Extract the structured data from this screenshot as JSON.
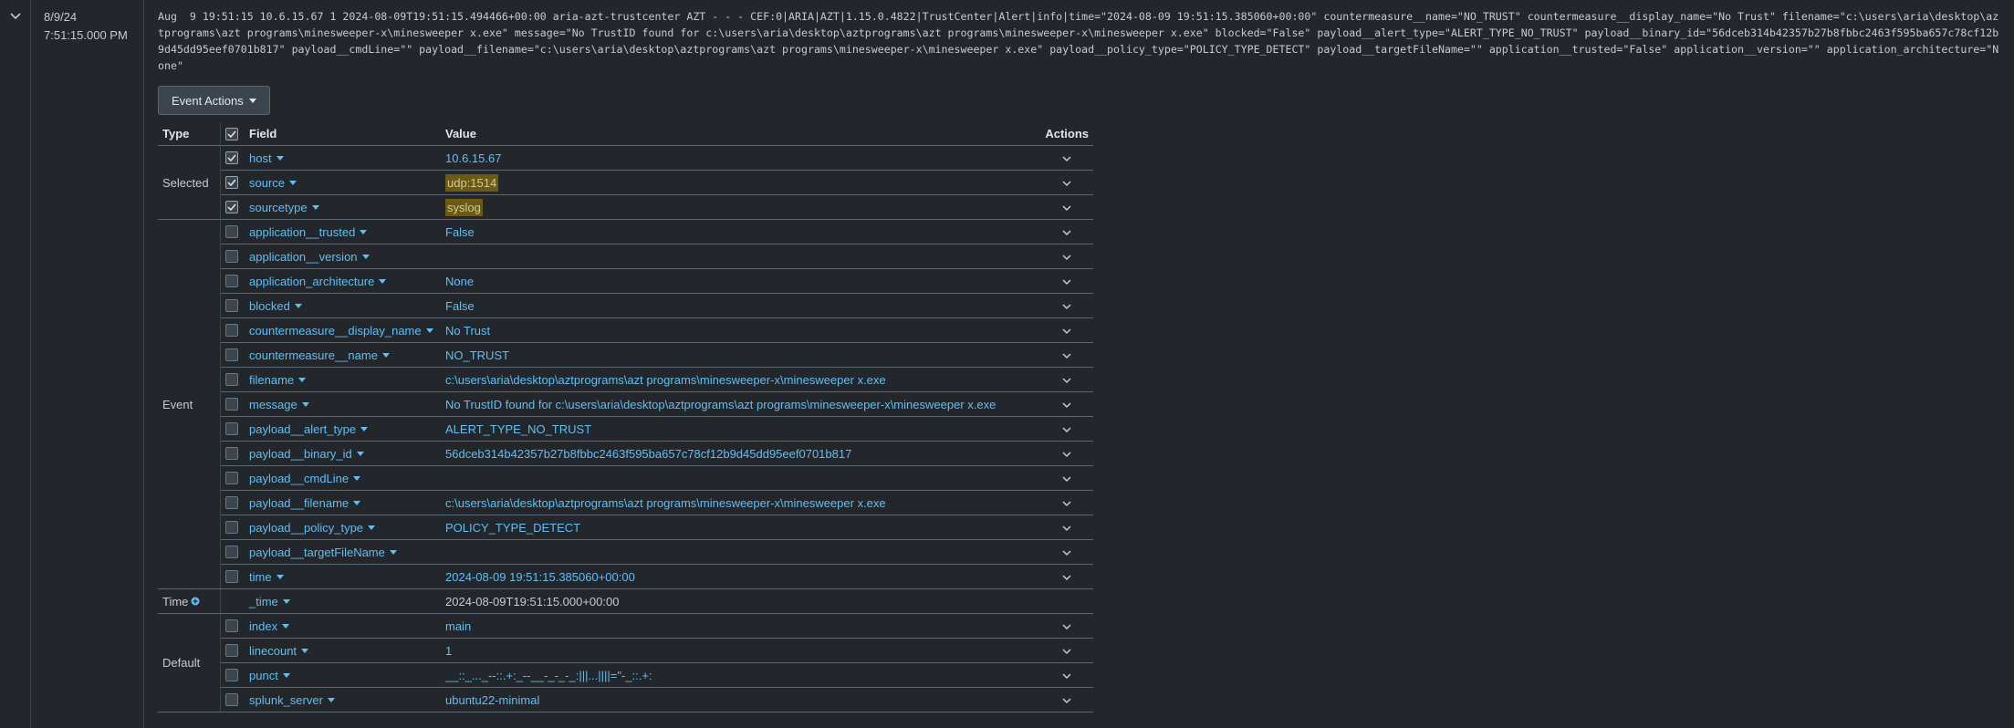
{
  "event": {
    "date": "8/9/24",
    "time": "7:51:15.000 PM",
    "raw": "Aug  9 19:51:15 10.6.15.67 1 2024-08-09T19:51:15.494466+00:00 aria-azt-trustcenter AZT - - - CEF:0|ARIA|AZT|1.15.0.4822|TrustCenter|Alert|info|time=\"2024-08-09 19:51:15.385060+00:00\" countermeasure__name=\"NO_TRUST\" countermeasure__display_name=\"No Trust\" filename=\"c:\\users\\aria\\desktop\\aztprograms\\azt programs\\minesweeper-x\\minesweeper x.exe\" message=\"No TrustID found for c:\\users\\aria\\desktop\\aztprograms\\azt programs\\minesweeper-x\\minesweeper x.exe\" blocked=\"False\" payload__alert_type=\"ALERT_TYPE_NO_TRUST\" payload__binary_id=\"56dceb314b42357b27b8fbbc2463f595ba657c78cf12b9d45dd95eef0701b817\" payload__cmdLine=\"\" payload__filename=\"c:\\users\\aria\\desktop\\aztprograms\\azt programs\\minesweeper-x\\minesweeper x.exe\" payload__policy_type=\"POLICY_TYPE_DETECT\" payload__targetFileName=\"\" application__trusted=\"False\" application__version=\"\" application_architecture=\"None\"",
    "actions_label": "Event Actions"
  },
  "table": {
    "headers": {
      "type": "Type",
      "field": "Field",
      "value": "Value",
      "actions": "Actions"
    },
    "type_labels": {
      "selected": "Selected",
      "event": "Event",
      "time": "Time",
      "default": "Default"
    },
    "selected": [
      {
        "field": "host",
        "value": "10.6.15.67",
        "checked": true,
        "highlight": false
      },
      {
        "field": "source",
        "value": "udp:1514",
        "checked": true,
        "highlight": true
      },
      {
        "field": "sourcetype",
        "value": "syslog",
        "checked": true,
        "highlight": true
      }
    ],
    "event_fields": [
      {
        "field": "application__trusted",
        "value": "False"
      },
      {
        "field": "application__version",
        "value": ""
      },
      {
        "field": "application_architecture",
        "value": "None"
      },
      {
        "field": "blocked",
        "value": "False"
      },
      {
        "field": "countermeasure__display_name",
        "value": "No Trust"
      },
      {
        "field": "countermeasure__name",
        "value": "NO_TRUST"
      },
      {
        "field": "filename",
        "value": "c:\\users\\aria\\desktop\\aztprograms\\azt programs\\minesweeper-x\\minesweeper x.exe"
      },
      {
        "field": "message",
        "value": "No TrustID found for c:\\users\\aria\\desktop\\aztprograms\\azt programs\\minesweeper-x\\minesweeper x.exe"
      },
      {
        "field": "payload__alert_type",
        "value": "ALERT_TYPE_NO_TRUST"
      },
      {
        "field": "payload__binary_id",
        "value": "56dceb314b42357b27b8fbbc2463f595ba657c78cf12b9d45dd95eef0701b817"
      },
      {
        "field": "payload__cmdLine",
        "value": ""
      },
      {
        "field": "payload__filename",
        "value": "c:\\users\\aria\\desktop\\aztprograms\\azt programs\\minesweeper-x\\minesweeper x.exe"
      },
      {
        "field": "payload__policy_type",
        "value": "POLICY_TYPE_DETECT"
      },
      {
        "field": "payload__targetFileName",
        "value": ""
      },
      {
        "field": "time",
        "value": "2024-08-09 19:51:15.385060+00:00"
      }
    ],
    "time_field": {
      "field": "_time",
      "value": "2024-08-09T19:51:15.000+00:00"
    },
    "default_fields": [
      {
        "field": "index",
        "value": "main"
      },
      {
        "field": "linecount",
        "value": "1"
      },
      {
        "field": "punct",
        "value": "__::_..._--::.+:_--__-_-_-_:|||...||||=\"-_::.+:"
      },
      {
        "field": "splunk_server",
        "value": "ubuntu22-minimal"
      }
    ]
  },
  "colors": {
    "background": "#23272b",
    "link": "#5cc0f5",
    "highlight": "#6b5a13",
    "text": "#c3cbd4"
  }
}
